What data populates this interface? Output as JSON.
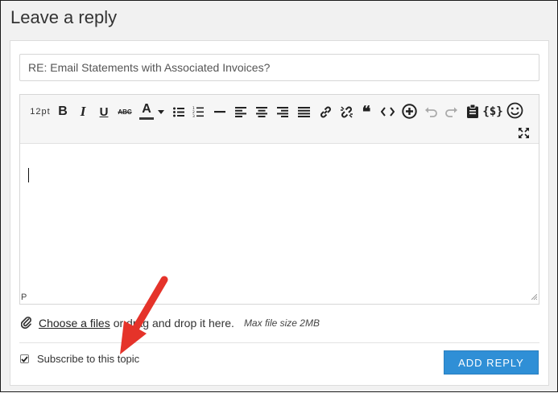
{
  "header": {
    "title": "Leave a reply"
  },
  "subject": {
    "value": "RE: Email Statements with Associated Invoices?"
  },
  "toolbar": {
    "font_size": "12pt",
    "icons": [
      "bold-icon",
      "italic-icon",
      "underline-icon",
      "strikethrough-icon",
      "text-color-icon",
      "bullet-list-icon",
      "numbered-list-icon",
      "horizontal-rule-icon",
      "align-left-icon",
      "align-center-icon",
      "align-right-icon",
      "align-justify-icon",
      "link-icon",
      "unlink-icon",
      "blockquote-icon",
      "code-icon",
      "insert-plus-icon",
      "undo-icon",
      "redo-icon",
      "paste-icon",
      "code-brace-icon",
      "emoji-icon",
      "fullscreen-icon"
    ]
  },
  "editor": {
    "status_path": "P"
  },
  "attachment": {
    "link_label": "Choose a files",
    "rest_text": "or drag and drop it here.",
    "max_size": "Max file size 2MB"
  },
  "subscribe": {
    "label": "Subscribe to this topic",
    "checked": true
  },
  "actions": {
    "add_reply_label": "ADD REPLY"
  },
  "colors": {
    "button": "#2f8fd6",
    "annotation_arrow": "#e5332a"
  }
}
